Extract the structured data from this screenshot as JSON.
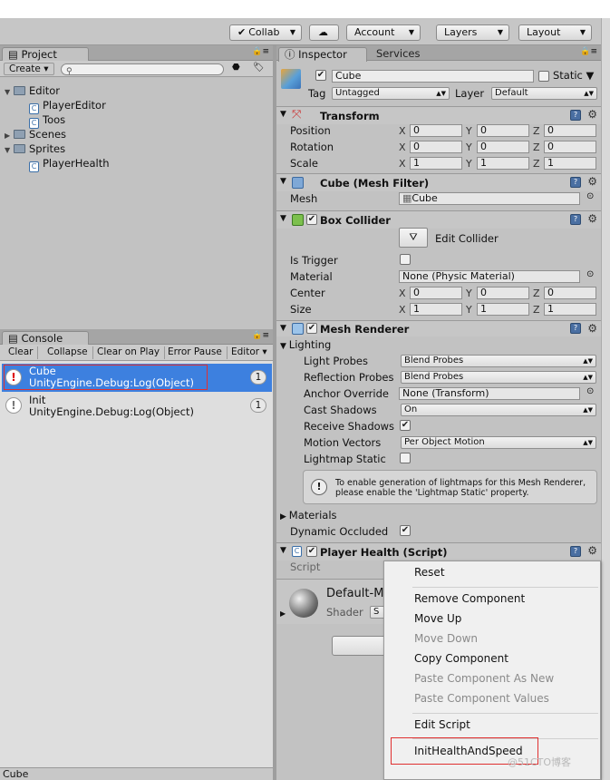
{
  "toolbar": {
    "collab": "Collab",
    "account": "Account",
    "layers": "Layers",
    "layout": "Layout",
    "collab_icon": "check-circle-icon",
    "cloud_icon": "cloud-icon"
  },
  "project": {
    "tab": "Project",
    "create": "Create",
    "search_placeholder": "",
    "tree": [
      {
        "label": "Editor",
        "type": "folder"
      },
      {
        "label": "PlayerEditor",
        "type": "script"
      },
      {
        "label": "Toos",
        "type": "script"
      },
      {
        "label": "Scenes",
        "type": "folder"
      },
      {
        "label": "Sprites",
        "type": "folder"
      },
      {
        "label": "PlayerHealth",
        "type": "script"
      }
    ]
  },
  "console": {
    "tab": "Console",
    "buttons": [
      "Clear",
      "Collapse",
      "Clear on Play",
      "Error Pause",
      "Editor"
    ],
    "logs": [
      {
        "line1": "Cube",
        "line2": "UnityEngine.Debug:Log(Object)",
        "count": "1"
      },
      {
        "line1": "Init",
        "line2": "UnityEngine.Debug:Log(Object)",
        "count": "1"
      }
    ]
  },
  "status": "Cube",
  "inspector": {
    "tab": "Inspector",
    "tab2": "Services",
    "name": "Cube",
    "static_label": "Static",
    "tag_label": "Tag",
    "tag_value": "Untagged",
    "layer_label": "Layer",
    "layer_value": "Default",
    "transform": {
      "title": "Transform",
      "position_label": "Position",
      "rotation_label": "Rotation",
      "scale_label": "Scale",
      "position": [
        "0",
        "0",
        "0"
      ],
      "rotation": [
        "0",
        "0",
        "0"
      ],
      "scale": [
        "1",
        "1",
        "1"
      ],
      "axes": [
        "X",
        "Y",
        "Z"
      ]
    },
    "mesh_filter": {
      "title": "Cube (Mesh Filter)",
      "mesh_label": "Mesh",
      "mesh_value": "Cube"
    },
    "box_collider": {
      "title": "Box Collider",
      "edit_collider": "Edit Collider",
      "is_trigger": "Is Trigger",
      "material_label": "Material",
      "material_value": "None (Physic Material)",
      "center_label": "Center",
      "size_label": "Size",
      "center": [
        "0",
        "0",
        "0"
      ],
      "size": [
        "1",
        "1",
        "1"
      ]
    },
    "mesh_renderer": {
      "title": "Mesh Renderer",
      "lighting": "Lighting",
      "light_probes_label": "Light Probes",
      "light_probes": "Blend Probes",
      "reflection_probes_label": "Reflection Probes",
      "reflection_probes": "Blend Probes",
      "anchor_label": "Anchor Override",
      "anchor_value": "None (Transform)",
      "cast_shadows_label": "Cast Shadows",
      "cast_shadows": "On",
      "receive_shadows_label": "Receive Shadows",
      "motion_vectors_label": "Motion Vectors",
      "motion_vectors": "Per Object Motion",
      "lightmap_static_label": "Lightmap Static",
      "info": "To enable generation of lightmaps for this Mesh Renderer, please enable the 'Lightmap Static' property.",
      "materials": "Materials",
      "dynamic_occluded": "Dynamic Occluded"
    },
    "player_health": {
      "title": "Player Health (Script)",
      "script_label": "Script"
    },
    "material": {
      "name": "Default-Ma",
      "shader_label": "Shader",
      "shader_value": "S"
    }
  },
  "context_menu": {
    "items": [
      {
        "label": "Reset",
        "enabled": true
      },
      {
        "label": "Remove Component",
        "enabled": true
      },
      {
        "label": "Move Up",
        "enabled": true
      },
      {
        "label": "Move Down",
        "enabled": false
      },
      {
        "label": "Copy Component",
        "enabled": true
      },
      {
        "label": "Paste Component As New",
        "enabled": false
      },
      {
        "label": "Paste Component Values",
        "enabled": false
      },
      {
        "label": "Edit Script",
        "enabled": true
      },
      {
        "label": "InitHealthAndSpeed",
        "enabled": true
      }
    ]
  },
  "watermark": "@51CTO博客"
}
